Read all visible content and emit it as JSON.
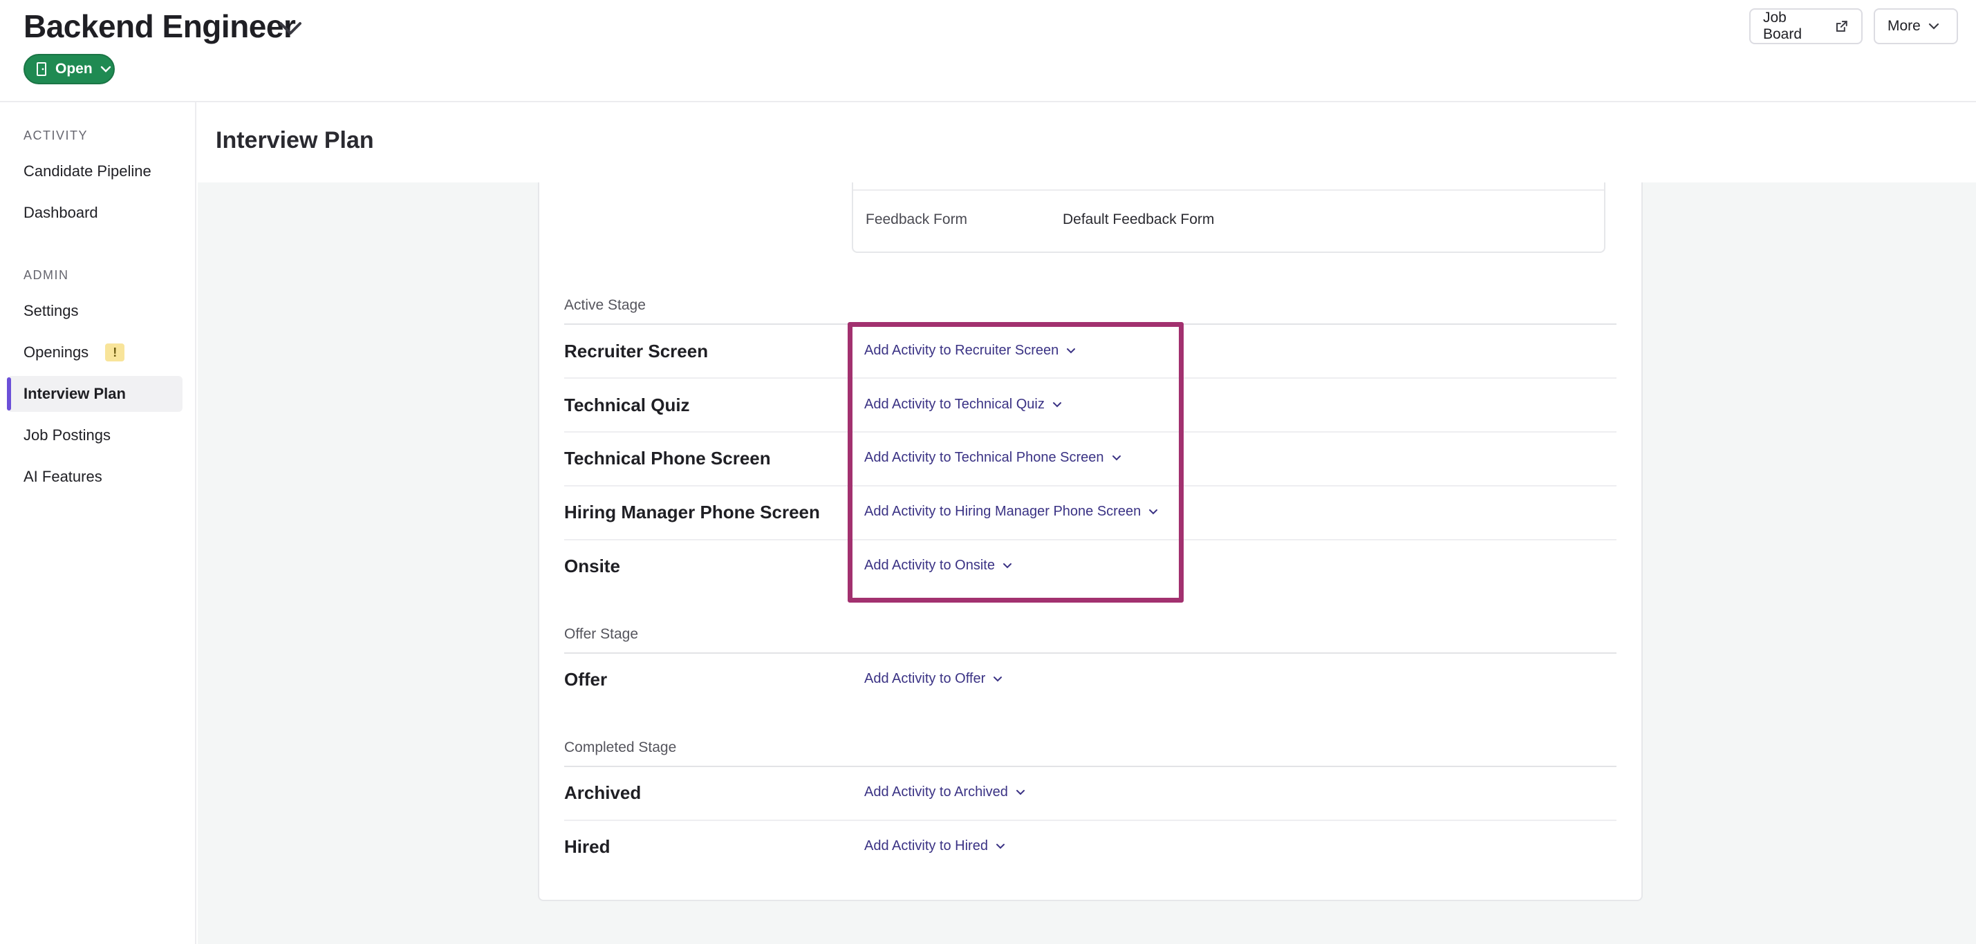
{
  "header": {
    "title": "Backend Engineer",
    "status": "Open",
    "job_board": "Job Board",
    "more": "More"
  },
  "sidebar": {
    "sections": [
      {
        "title": "ACTIVITY",
        "items": [
          {
            "label": "Candidate Pipeline"
          },
          {
            "label": "Dashboard"
          }
        ]
      },
      {
        "title": "ADMIN",
        "items": [
          {
            "label": "Settings"
          },
          {
            "label": "Openings",
            "badge": "!"
          },
          {
            "label": "Interview Plan",
            "active": true
          },
          {
            "label": "Job Postings"
          },
          {
            "label": "AI Features"
          }
        ]
      }
    ]
  },
  "main": {
    "title": "Interview Plan",
    "feedback": {
      "label": "Feedback Form",
      "value": "Default Feedback Form"
    },
    "groups": [
      {
        "title": "Active Stage",
        "stages": [
          {
            "name": "Recruiter Screen",
            "action": "Add Activity to Recruiter Screen"
          },
          {
            "name": "Technical Quiz",
            "action": "Add Activity to Technical Quiz"
          },
          {
            "name": "Technical Phone Screen",
            "action": "Add Activity to Technical Phone Screen"
          },
          {
            "name": "Hiring Manager Phone Screen",
            "action": "Add Activity to Hiring Manager Phone Screen"
          },
          {
            "name": "Onsite",
            "action": "Add Activity to Onsite"
          }
        ]
      },
      {
        "title": "Offer Stage",
        "stages": [
          {
            "name": "Offer",
            "action": "Add Activity to Offer"
          }
        ]
      },
      {
        "title": "Completed Stage",
        "stages": [
          {
            "name": "Archived",
            "action": "Add Activity to Archived"
          },
          {
            "name": "Hired",
            "action": "Add Activity to Hired"
          }
        ]
      }
    ]
  },
  "colors": {
    "status_green": "#1f8a52",
    "link_purple": "#3a3284",
    "highlight": "#a2316f",
    "active_nav_accent": "#6b4fd8"
  }
}
